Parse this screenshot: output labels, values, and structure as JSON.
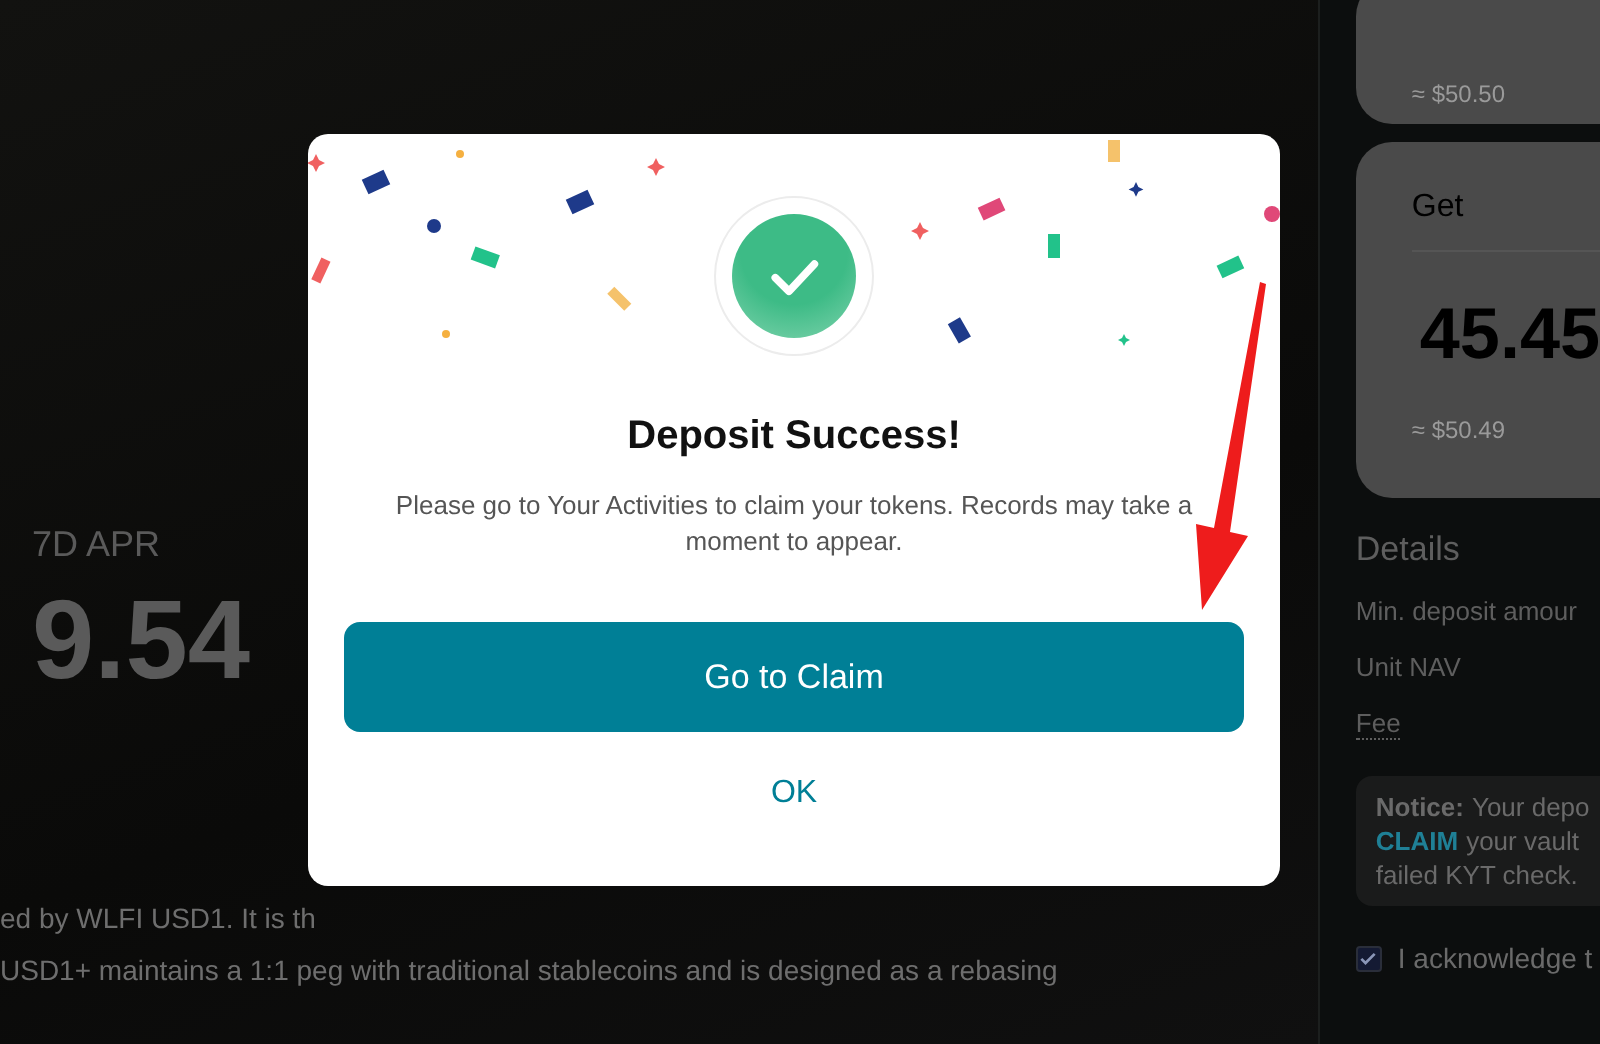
{
  "page": {
    "apr_label": "7D APR",
    "apr_value": "9.54",
    "description": [
      "ed by WLFI USD1. It is th",
      "USD1+ maintains a 1:1 peg with traditional stablecoins and is designed as a rebasing"
    ]
  },
  "side_panel": {
    "pay_card": {
      "usd_value": "≈ $50.50"
    },
    "get_card": {
      "label": "Get",
      "amount": "45.45",
      "usd_value": "≈ $50.49"
    },
    "details_title": "Details",
    "details": [
      "Min. deposit amour",
      "Unit NAV",
      "Fee"
    ],
    "notice": {
      "label": "Notice:",
      "text_1": "Your depo",
      "link": "CLAIM",
      "text_2": "your vault",
      "text_3": "failed KYT check."
    },
    "acknowledge": {
      "label": "I acknowledge t",
      "checked": true
    }
  },
  "dialog": {
    "title": "Deposit Success!",
    "message": "Please go to Your Activities to claim your tokens. Records may take a moment to appear.",
    "primary_button": "Go to Claim",
    "secondary_button": "OK"
  }
}
